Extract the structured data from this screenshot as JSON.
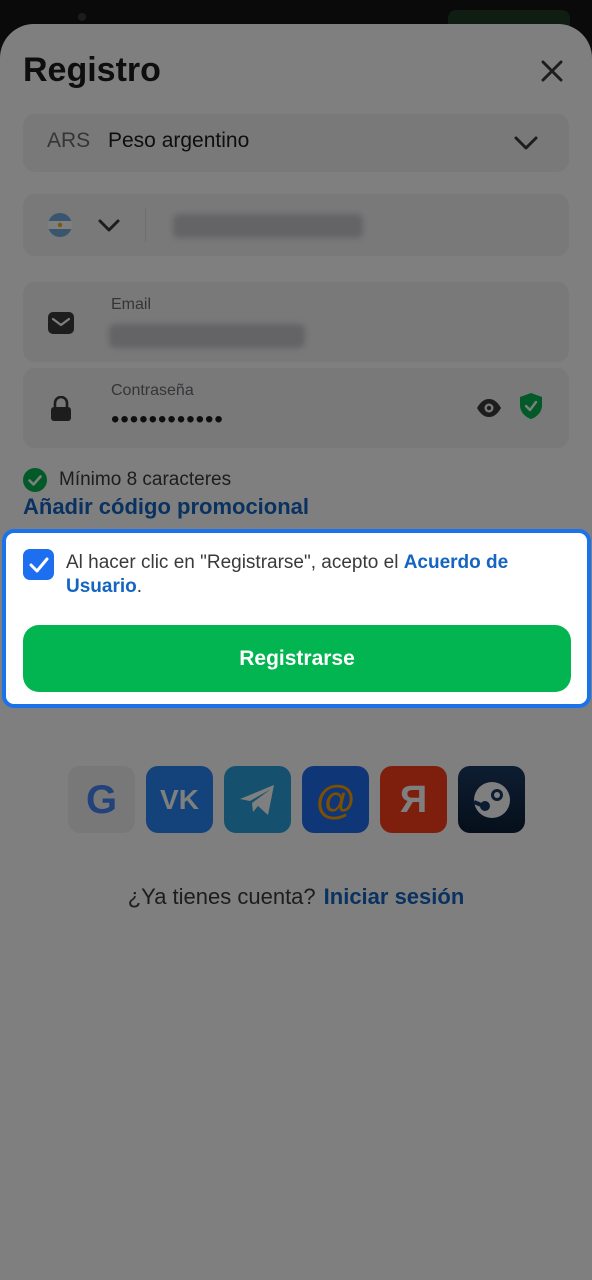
{
  "header": {
    "title": "Registro",
    "close_icon": "close-icon"
  },
  "form": {
    "currency": {
      "code": "ARS",
      "name": "Peso argentino"
    },
    "phone": {
      "country_icon": "argentina-flag-icon",
      "value_blurred": true
    },
    "email": {
      "label": "Email",
      "value_blurred": true
    },
    "password": {
      "label": "Contraseña",
      "value": "••••••••••••"
    },
    "password_hint": "Mínimo 8 caracteres",
    "promo_link": "Añadir código promocional"
  },
  "agreement": {
    "checked": true,
    "text": "Al hacer clic en \"Registrarse\", acepto el ",
    "link": "Acuerdo de Usuario",
    "suffix": "."
  },
  "register_button": "Registrarse",
  "social": [
    {
      "name": "google",
      "icon": "google-icon"
    },
    {
      "name": "vk",
      "icon": "vk-icon"
    },
    {
      "name": "telegram",
      "icon": "telegram-icon"
    },
    {
      "name": "mail",
      "icon": "mail-at-icon"
    },
    {
      "name": "yandex",
      "icon": "yandex-icon"
    },
    {
      "name": "steam",
      "icon": "steam-icon"
    }
  ],
  "footer": {
    "question": "¿Ya tienes cuenta?",
    "login_link": "Iniciar sesión"
  },
  "colors": {
    "primary_green": "#03b550",
    "link_blue": "#1565c0",
    "highlight_blue": "#1a73e8",
    "check_blue": "#1e6ff0"
  }
}
